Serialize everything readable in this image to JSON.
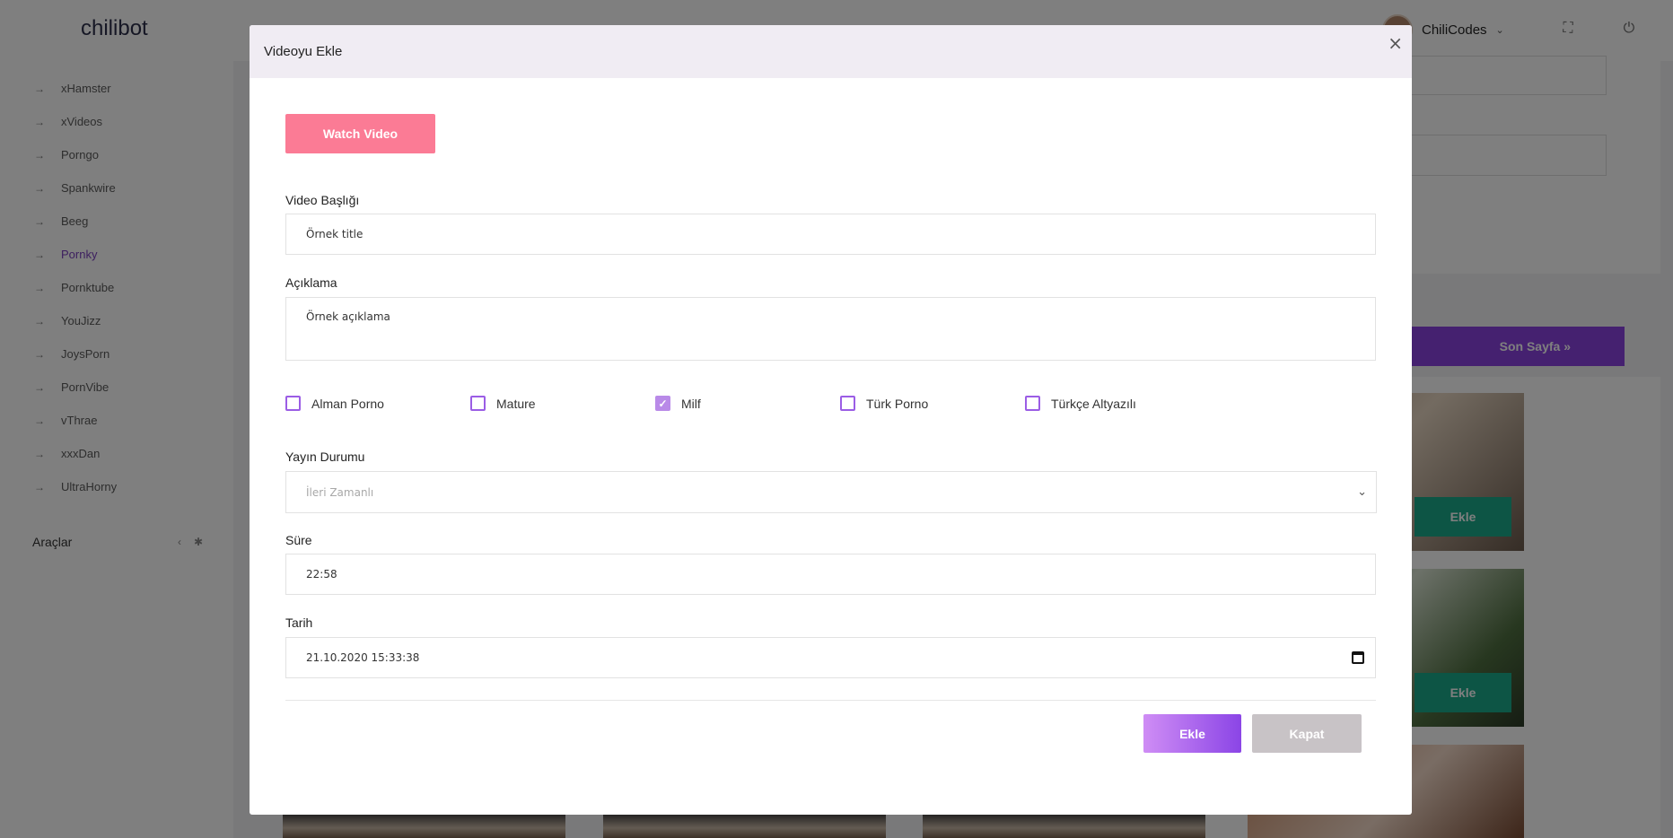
{
  "app": {
    "brand": "chilibot"
  },
  "sidebar": {
    "items": [
      {
        "label": "xHamster"
      },
      {
        "label": "xVideos"
      },
      {
        "label": "Porngo"
      },
      {
        "label": "Spankwire"
      },
      {
        "label": "Beeg"
      },
      {
        "label": "Pornky",
        "active": true
      },
      {
        "label": "Pornktube"
      },
      {
        "label": "YouJizz"
      },
      {
        "label": "JoysPorn"
      },
      {
        "label": "PornVibe"
      },
      {
        "label": "vThrae"
      },
      {
        "label": "xxxDan"
      },
      {
        "label": "UltraHorny"
      }
    ],
    "tools_label": "Araçlar"
  },
  "topbar": {
    "username": "ChiliCodes"
  },
  "background": {
    "last_page_label": "Son Sayfa »",
    "add_label": "Ekle"
  },
  "modal": {
    "title": "Videoyu Ekle",
    "close_symbol": "×",
    "watch_label": "Watch Video",
    "title_field": {
      "label": "Video Başlığı",
      "value": "Örnek title"
    },
    "description_field": {
      "label": "Açıklama",
      "value": "Örnek açıklama"
    },
    "categories": [
      {
        "label": "Alman Porno",
        "checked": false
      },
      {
        "label": "Mature",
        "checked": false
      },
      {
        "label": "Milf",
        "checked": true
      },
      {
        "label": "Türk Porno",
        "checked": false
      },
      {
        "label": "Türkçe Altyazılı",
        "checked": false
      }
    ],
    "status_field": {
      "label": "Yayın Durumu",
      "value": "İleri Zamanlı"
    },
    "duration_field": {
      "label": "Süre",
      "value": "22:58"
    },
    "date_field": {
      "label": "Tarih",
      "value": "21.10.2020 15:33:38"
    },
    "submit_label": "Ekle",
    "cancel_label": "Kapat"
  },
  "colors": {
    "watch_button": "#fb7b95",
    "submit_gradient_start": "#cf8df5",
    "submit_gradient_end": "#8b45e6",
    "cancel_button": "#c8c3c6",
    "checkbox_accent": "#9b5de5",
    "active_menu": "#7a3fbf",
    "add_button": "#1aab8a"
  }
}
